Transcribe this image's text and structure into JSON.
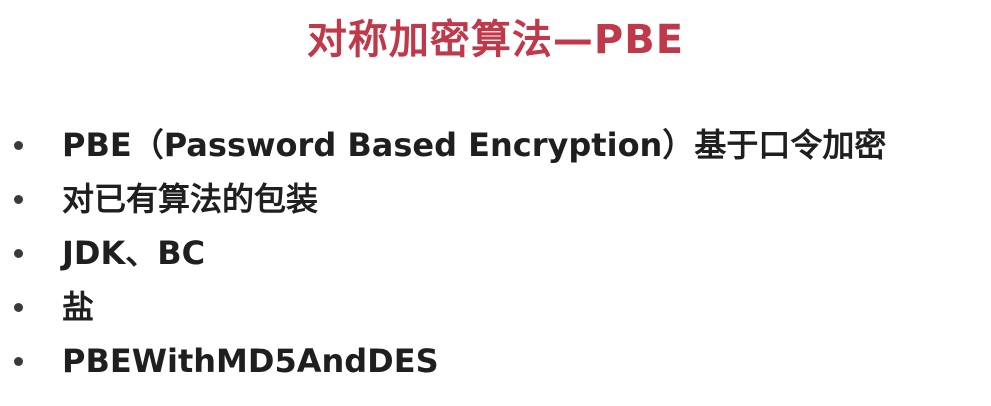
{
  "slide": {
    "title": "对称加密算法—PBE",
    "bullets": [
      {
        "text": "PBE（Password Based Encryption）基于口令加密"
      },
      {
        "text": "对已有算法的包装"
      },
      {
        "text": "JDK、BC"
      },
      {
        "text": "盐"
      },
      {
        "text": "PBEWithMD5AndDES"
      }
    ]
  },
  "colors": {
    "title": "#c0394b",
    "body_text": "#1f1f1f",
    "bullet_dot": "#3a3a3a",
    "background": "#ffffff"
  }
}
